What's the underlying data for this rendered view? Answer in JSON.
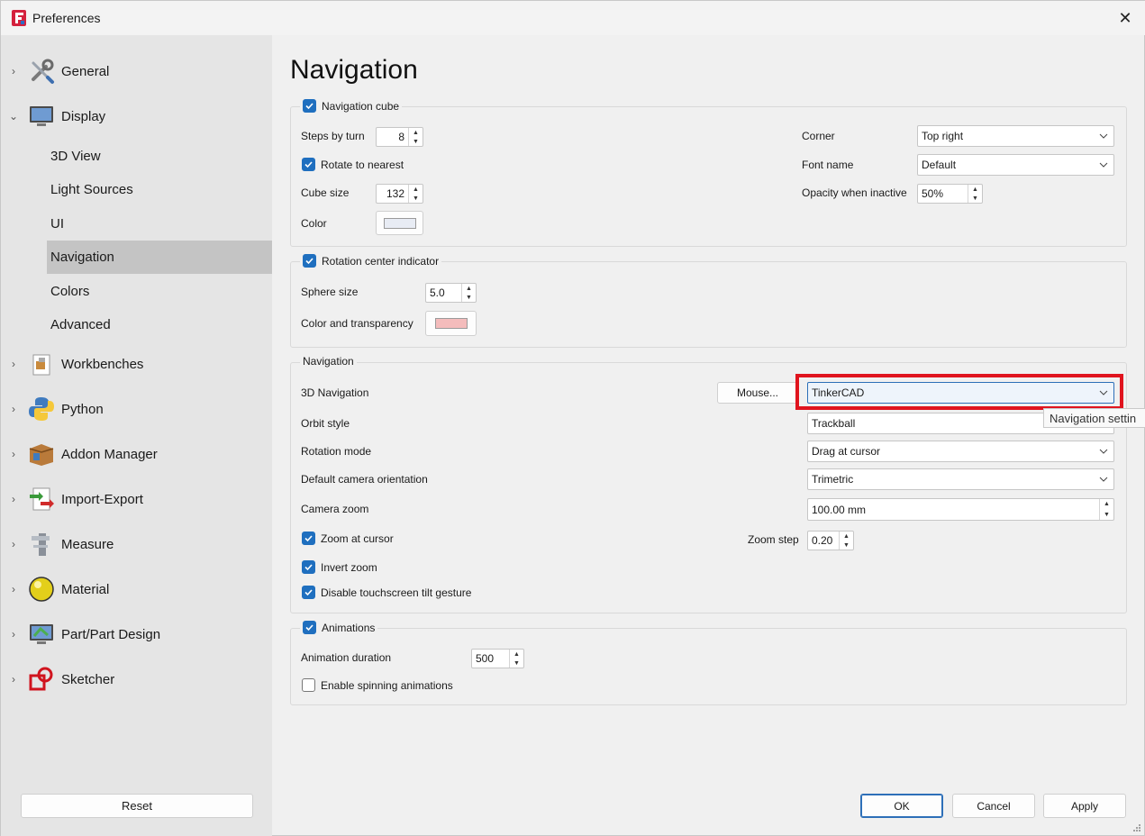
{
  "window": {
    "title": "Preferences",
    "close_symbol": "✕"
  },
  "sidebar": {
    "items": [
      {
        "label": "General",
        "icon": "wrench-screwdriver-icon",
        "expanded": false
      },
      {
        "label": "Display",
        "icon": "monitor-icon",
        "expanded": true,
        "children": [
          "3D View",
          "Light Sources",
          "UI",
          "Navigation",
          "Colors",
          "Advanced"
        ],
        "selected_child": "Navigation"
      },
      {
        "label": "Workbenches",
        "icon": "workbench-box-icon",
        "expanded": false
      },
      {
        "label": "Python",
        "icon": "python-icon",
        "expanded": false
      },
      {
        "label": "Addon Manager",
        "icon": "addon-box-icon",
        "expanded": false
      },
      {
        "label": "Import-Export",
        "icon": "import-export-icon",
        "expanded": false
      },
      {
        "label": "Measure",
        "icon": "measure-icon",
        "expanded": false
      },
      {
        "label": "Material",
        "icon": "material-sphere-icon",
        "expanded": false
      },
      {
        "label": "Part/Part Design",
        "icon": "part-design-icon",
        "expanded": false
      },
      {
        "label": "Sketcher",
        "icon": "sketcher-icon",
        "expanded": false
      }
    ],
    "reset_label": "Reset"
  },
  "page": {
    "title": "Navigation"
  },
  "nav_cube": {
    "title": "Navigation cube",
    "checked": true,
    "steps_label": "Steps by turn",
    "steps_value": "8",
    "rotate_label": "Rotate to nearest",
    "rotate_checked": true,
    "cube_size_label": "Cube size",
    "cube_size_value": "132",
    "color_label": "Color",
    "color_value": "#e8ecf4",
    "corner_label": "Corner",
    "corner_value": "Top right",
    "font_label": "Font name",
    "font_value": "Default",
    "opacity_label": "Opacity when inactive",
    "opacity_value": "50%"
  },
  "rotation_center": {
    "title": "Rotation center indicator",
    "checked": true,
    "sphere_label": "Sphere size",
    "sphere_value": "5.0",
    "color_label": "Color and transparency",
    "color_value": "#f4bcbc"
  },
  "navigation": {
    "title": "Navigation",
    "nav3d_label": "3D Navigation",
    "mouse_button": "Mouse...",
    "nav3d_value": "TinkerCAD",
    "orbit_label": "Orbit style",
    "orbit_value": "Trackball",
    "rotation_label": "Rotation mode",
    "rotation_value": "Drag at cursor",
    "camera_orient_label": "Default camera orientation",
    "camera_orient_value": "Trimetric",
    "camera_zoom_label": "Camera zoom",
    "camera_zoom_value": "100.00 mm",
    "zoom_cursor_label": "Zoom at cursor",
    "zoom_cursor_checked": true,
    "zoom_step_label": "Zoom step",
    "zoom_step_value": "0.20",
    "invert_zoom_label": "Invert zoom",
    "invert_zoom_checked": true,
    "tilt_label": "Disable touchscreen tilt gesture",
    "tilt_checked": true,
    "tooltip": "Navigation settin"
  },
  "animations": {
    "title": "Animations",
    "checked": true,
    "duration_label": "Animation duration",
    "duration_value": "500",
    "spinning_label": "Enable spinning animations",
    "spinning_checked": false
  },
  "footer": {
    "ok": "OK",
    "cancel": "Cancel",
    "apply": "Apply"
  },
  "colors": {
    "accent": "#1f6fbf",
    "highlight": "#e0141e",
    "sidebar_selected": "#c4c4c4"
  }
}
